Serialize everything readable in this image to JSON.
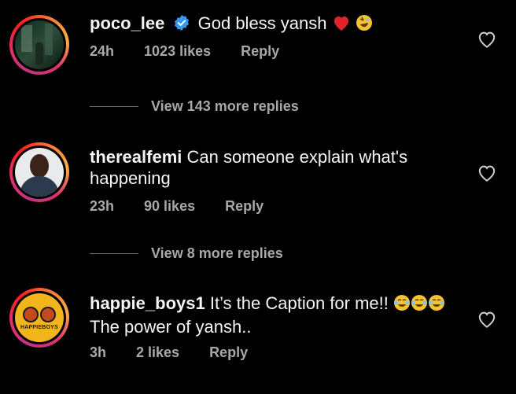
{
  "comments": [
    {
      "username": "poco_lee",
      "text": "God bless yansh",
      "time": "24h",
      "likes": "1023 likes",
      "reply": "Reply",
      "verified": true,
      "view_more": "View 143 more replies"
    },
    {
      "username": "therealfemi",
      "text_line1": "Can someone explain what's",
      "text_line2": "happening",
      "time": "23h",
      "likes": "90 likes",
      "reply": "Reply",
      "view_more": "View 8 more replies"
    },
    {
      "username": "happie_boys1",
      "text_line1": "It’s the Caption for me!!",
      "text_line2": "The power of yansh..",
      "time": "3h",
      "likes": "2 likes",
      "reply": "Reply",
      "avatar_text": "HAPPIEBOYS"
    }
  ],
  "colors": {
    "background": "#000000",
    "muted": "#a8a8a8",
    "verified": "#3897f0"
  }
}
